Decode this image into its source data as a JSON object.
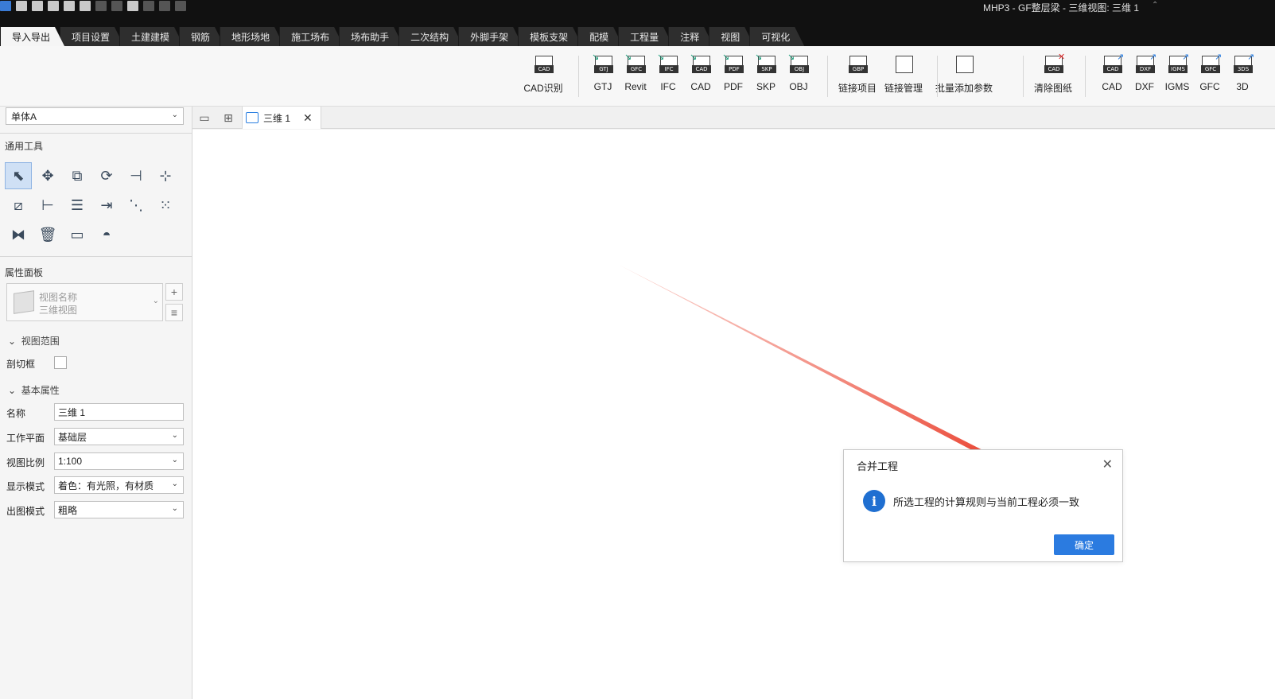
{
  "window": {
    "title": "MHP3 - GF整层梁 - 三维视图: 三维 1",
    "menu_glyph": "⌃"
  },
  "ribbon": {
    "tabs": [
      "导入导出",
      "项目设置",
      "土建建模",
      "钢筋",
      "地形场地",
      "施工场布",
      "场布助手",
      "二次结构",
      "外脚手架",
      "模板支架",
      "配模",
      "工程量",
      "注释",
      "视图",
      "可视化"
    ],
    "active_tab": "导入导出",
    "buttons": [
      {
        "label": "CAD识别",
        "tag": "CAD",
        "icon": "cad-recognize-icon"
      },
      {
        "label": "GTJ",
        "tag": "GTJ",
        "icon": "import-gtj-icon"
      },
      {
        "label": "Revit",
        "tag": "GFC",
        "icon": "import-revit-icon"
      },
      {
        "label": "IFC",
        "tag": "IFC",
        "icon": "import-ifc-icon"
      },
      {
        "label": "CAD",
        "tag": "CAD",
        "icon": "import-cad-icon"
      },
      {
        "label": "PDF",
        "tag": "PDF",
        "icon": "import-pdf-icon"
      },
      {
        "label": "SKP",
        "tag": "SKP",
        "icon": "import-skp-icon"
      },
      {
        "label": "OBJ",
        "tag": "OBJ",
        "icon": "import-obj-icon"
      },
      {
        "label": "链接项目",
        "tag": "GBP",
        "icon": "link-project-icon"
      },
      {
        "label": "链接管理",
        "tag": "",
        "icon": "link-manage-icon"
      },
      {
        "label": "批量添加参数",
        "tag": "",
        "icon": "batch-params-icon"
      },
      {
        "label": "清除图纸",
        "tag": "CAD",
        "icon": "clear-drawing-icon"
      },
      {
        "label": "CAD",
        "tag": "CAD",
        "icon": "export-cad-icon"
      },
      {
        "label": "DXF",
        "tag": "DXF",
        "icon": "export-dxf-icon"
      },
      {
        "label": "IGMS",
        "tag": "IGMS",
        "icon": "export-igms-icon"
      },
      {
        "label": "GFC",
        "tag": "GFC",
        "icon": "export-gfc-icon"
      },
      {
        "label": "3D",
        "tag": "3DS",
        "icon": "export-3d-icon"
      }
    ]
  },
  "left": {
    "unit_select": "单体A",
    "tools_header": "通用工具",
    "props_header": "属性面板",
    "view_card": {
      "line1": "视图名称",
      "line2": "三维视图"
    },
    "group_range": "视图范围",
    "group_basic": "基本属性",
    "props": [
      {
        "label": "剖切框",
        "type": "checkbox",
        "value": ""
      },
      {
        "label": "名称",
        "type": "text",
        "value": "三维 1"
      },
      {
        "label": "工作平面",
        "type": "select",
        "value": "基础层"
      },
      {
        "label": "视图比例",
        "type": "select",
        "value": "1:100"
      },
      {
        "label": "显示模式",
        "type": "select",
        "value": "着色：有光照，有材质"
      },
      {
        "label": "出图模式",
        "type": "select",
        "value": "粗略"
      }
    ]
  },
  "doc_tab": {
    "label": "三维 1"
  },
  "dialog": {
    "title": "合并工程",
    "message": "所选工程的计算规则与当前工程必须一致",
    "ok": "确定"
  },
  "colors": {
    "accent": "#2b7be0",
    "annotation_arrow": "#e8321e",
    "titlebar": "#111111"
  }
}
